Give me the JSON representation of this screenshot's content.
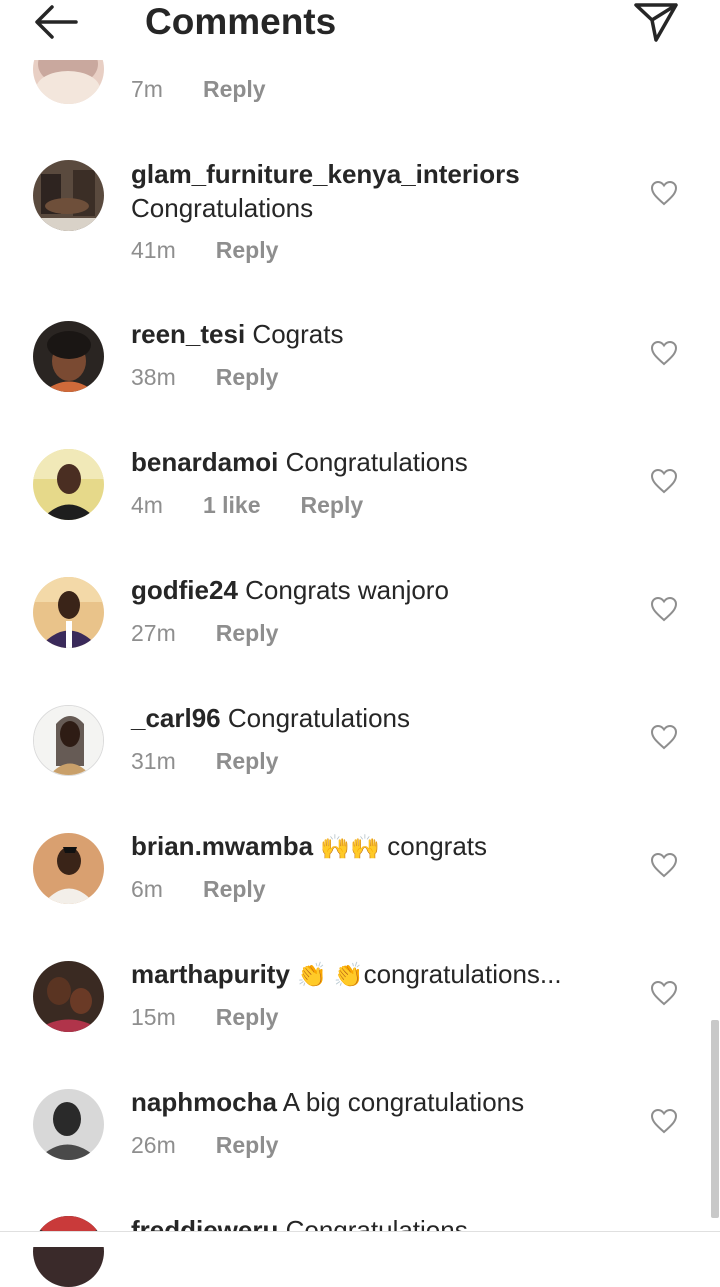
{
  "header": {
    "title": "Comments",
    "back_icon": "arrow-left-icon",
    "share_icon": "paper-plane-icon"
  },
  "partial_top": {
    "time": "7m",
    "reply": "Reply"
  },
  "comments": [
    {
      "username": "glam_furniture_kenya_interiors",
      "text": "Congratulations",
      "time": "41m",
      "reply": "Reply",
      "multiline": true
    },
    {
      "username": "reen_tesi",
      "text": "Cograts",
      "time": "38m",
      "reply": "Reply"
    },
    {
      "username": "benardamoi",
      "text": "Congratulations",
      "time": "4m",
      "likes": "1 like",
      "reply": "Reply"
    },
    {
      "username": "godfie24",
      "text": "Congrats wanjoro",
      "time": "27m",
      "reply": "Reply"
    },
    {
      "username": "_carl96",
      "text": "Congratulations",
      "time": "31m",
      "reply": "Reply"
    },
    {
      "username": "brian.mwamba",
      "emoji": "🙌🙌",
      "text": "congrats",
      "time": "6m",
      "reply": "Reply"
    },
    {
      "username": "marthapurity",
      "emoji": "👏 👏",
      "text": "congratulations...",
      "time": "15m",
      "reply": "Reply"
    },
    {
      "username": "naphmocha",
      "text": "A big congratulations",
      "time": "26m",
      "reply": "Reply"
    }
  ],
  "partial_bottom": {
    "username": "freddieweru",
    "text": "Congratulations"
  },
  "colors": {
    "text": "#262626",
    "secondary": "#8e8e8e",
    "background": "#ffffff"
  }
}
